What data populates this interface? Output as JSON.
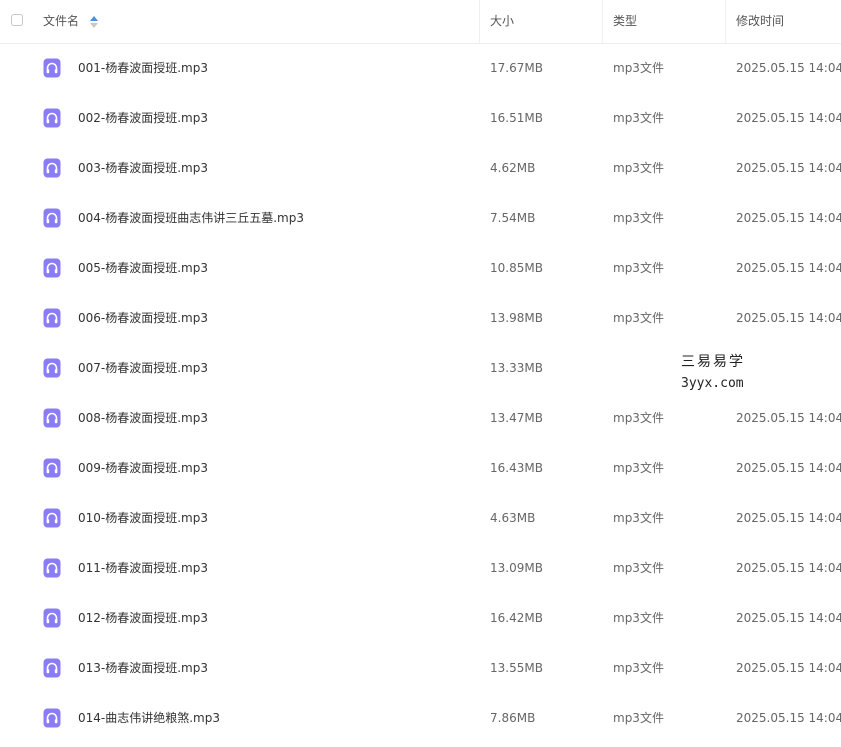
{
  "header": {
    "name_label": "文件名",
    "size_label": "大小",
    "type_label": "类型",
    "modified_label": "修改时间"
  },
  "files": [
    {
      "name": "001-杨春波面授班.mp3",
      "size": "17.67MB",
      "type": "mp3文件",
      "modified": "2025.05.15 14:04"
    },
    {
      "name": "002-杨春波面授班.mp3",
      "size": "16.51MB",
      "type": "mp3文件",
      "modified": "2025.05.15 14:04"
    },
    {
      "name": "003-杨春波面授班.mp3",
      "size": "4.62MB",
      "type": "mp3文件",
      "modified": "2025.05.15 14:04"
    },
    {
      "name": "004-杨春波面授班曲志伟讲三丘五墓.mp3",
      "size": "7.54MB",
      "type": "mp3文件",
      "modified": "2025.05.15 14:04"
    },
    {
      "name": "005-杨春波面授班.mp3",
      "size": "10.85MB",
      "type": "mp3文件",
      "modified": "2025.05.15 14:04"
    },
    {
      "name": "006-杨春波面授班.mp3",
      "size": "13.98MB",
      "type": "mp3文件",
      "modified": "2025.05.15 14:04"
    },
    {
      "name": "007-杨春波面授班.mp3",
      "size": "13.33MB",
      "type": "",
      "modified": ""
    },
    {
      "name": "008-杨春波面授班.mp3",
      "size": "13.47MB",
      "type": "mp3文件",
      "modified": "2025.05.15 14:04"
    },
    {
      "name": "009-杨春波面授班.mp3",
      "size": "16.43MB",
      "type": "mp3文件",
      "modified": "2025.05.15 14:04"
    },
    {
      "name": "010-杨春波面授班.mp3",
      "size": "4.63MB",
      "type": "mp3文件",
      "modified": "2025.05.15 14:04"
    },
    {
      "name": "011-杨春波面授班.mp3",
      "size": "13.09MB",
      "type": "mp3文件",
      "modified": "2025.05.15 14:04"
    },
    {
      "name": "012-杨春波面授班.mp3",
      "size": "16.42MB",
      "type": "mp3文件",
      "modified": "2025.05.15 14:04"
    },
    {
      "name": "013-杨春波面授班.mp3",
      "size": "13.55MB",
      "type": "mp3文件",
      "modified": "2025.05.15 14:04"
    },
    {
      "name": "014-曲志伟讲绝粮煞.mp3",
      "size": "7.86MB",
      "type": "mp3文件",
      "modified": "2025.05.15 14:04"
    }
  ],
  "watermark": {
    "line1": "三易易学",
    "line2": "3yyx.com"
  },
  "icons": {
    "file_icon": "audio-file-icon",
    "sort_icon": "sort-toggle-icon"
  },
  "colors": {
    "file_icon_bg": "#8a7cf6",
    "sort_up": "#4a90e2",
    "sort_down": "#c8c8c8"
  }
}
